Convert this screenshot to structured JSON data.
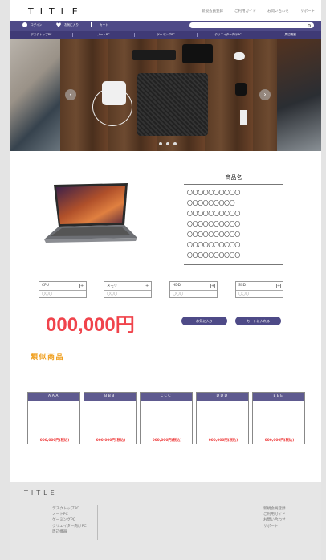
{
  "header": {
    "logo": "TITLE",
    "nav": [
      "新規会員登録",
      "ご利用ガイド",
      "お問い合わせ",
      "サポート"
    ]
  },
  "utility_bar": {
    "login": "ログイン",
    "favorites": "お気に入り",
    "cart": "カート",
    "search_placeholder": "キーワードを入力"
  },
  "categories": [
    "デスクトップPC",
    "ノートPC",
    "ゲーミングPC",
    "クリエイター向けPC",
    "周辺機器"
  ],
  "carousel": {
    "dots": 3,
    "active": 0
  },
  "product": {
    "name": "商品名",
    "spec_lines": [
      "〇〇〇〇〇〇〇〇〇〇",
      "〇〇〇〇〇〇〇〇〇",
      "〇〇〇〇〇〇〇〇〇〇",
      "〇〇〇〇〇〇〇〇〇〇",
      "〇〇〇〇〇〇〇〇〇〇",
      "〇〇〇〇〇〇〇〇〇〇",
      "〇〇〇〇〇〇〇〇〇〇",
      "〇〇〇〇〇〇〇〇〇〇"
    ],
    "options": [
      {
        "label": "CPU",
        "value": "〇〇〇"
      },
      {
        "label": "メモリ",
        "value": "〇〇〇"
      },
      {
        "label": "HDD",
        "value": "〇〇〇"
      },
      {
        "label": "SSD",
        "value": "〇〇〇"
      }
    ],
    "price": "000,000円",
    "favorite_button": "お気に入り",
    "cart_button": "カートに入れる"
  },
  "similar": {
    "title": "類似商品",
    "items": [
      {
        "name": "AAA",
        "price": "000,000円(税込)"
      },
      {
        "name": "BBB",
        "price": "000,000円(税込)"
      },
      {
        "name": "CCC",
        "price": "000,000円(税込)"
      },
      {
        "name": "DDD",
        "price": "000,000円(税込)"
      },
      {
        "name": "EEE",
        "price": "000,000円(税込)"
      }
    ]
  },
  "footer": {
    "logo": "TITLE",
    "left_links": [
      "デスクトップPC",
      "ノートPC",
      "ゲーミングPC",
      "クリエイター向けPC",
      "周辺機器"
    ],
    "right_links": [
      "新規会員登録",
      "ご利用ガイド",
      "お問い合わせ",
      "サポート"
    ]
  },
  "colors": {
    "accent": "#4e4a87",
    "price": "#f0444c",
    "similar_title": "#f0a020"
  }
}
